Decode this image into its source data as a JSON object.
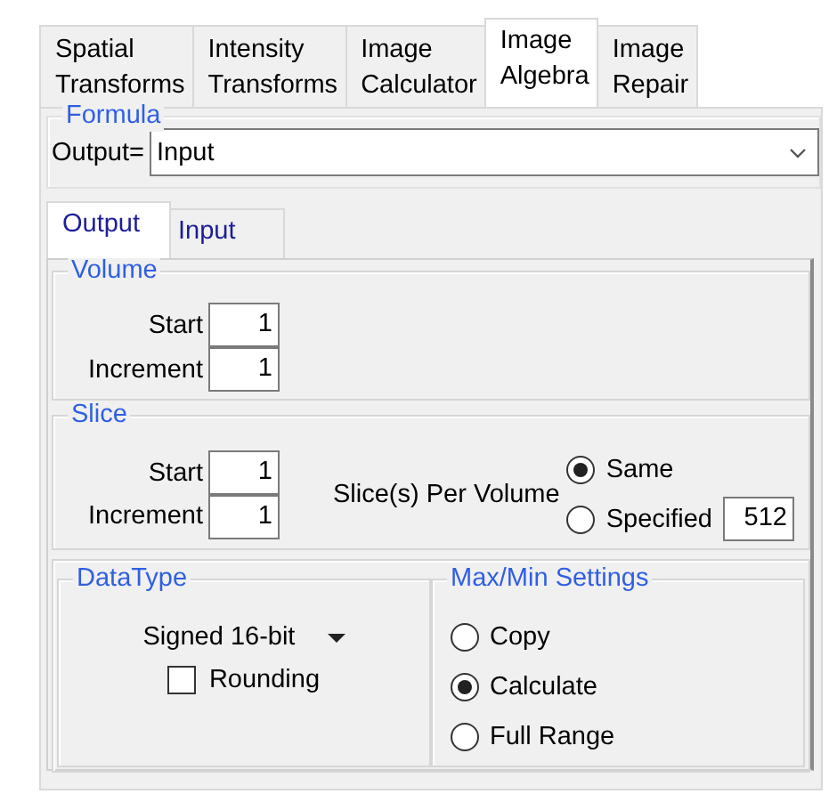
{
  "tabs": [
    {
      "label": "Spatial\nTransforms",
      "selected": false
    },
    {
      "label": "Intensity\nTransforms",
      "selected": false
    },
    {
      "label": "Image\nCalculator",
      "selected": false
    },
    {
      "label": "Image\nAlgebra",
      "selected": true
    },
    {
      "label": "Image\nRepair",
      "selected": false
    }
  ],
  "formula": {
    "title": "Formula",
    "output_label": "Output=",
    "output_value": "Input"
  },
  "subtabs": [
    {
      "label": "Output",
      "selected": true
    },
    {
      "label": "Input",
      "selected": false
    }
  ],
  "volume": {
    "title": "Volume",
    "fields": [
      {
        "label": "Start",
        "value": "1"
      },
      {
        "label": "Increment",
        "value": "1"
      }
    ]
  },
  "slice": {
    "title": "Slice",
    "fields": [
      {
        "label": "Start",
        "value": "1"
      },
      {
        "label": "Increment",
        "value": "1"
      }
    ],
    "per_volume_label": "Slice(s) Per Volume",
    "options": [
      {
        "label": "Same",
        "selected": true
      },
      {
        "label": "Specified",
        "selected": false,
        "value": "512"
      }
    ]
  },
  "datatype": {
    "title": "DataType",
    "type": "Signed 16-bit",
    "rounding": {
      "label": "Rounding",
      "checked": false
    }
  },
  "maxmin": {
    "title": "Max/Min Settings",
    "options": [
      {
        "label": "Copy",
        "selected": false
      },
      {
        "label": "Calculate",
        "selected": true
      },
      {
        "label": "Full Range",
        "selected": false
      }
    ]
  }
}
